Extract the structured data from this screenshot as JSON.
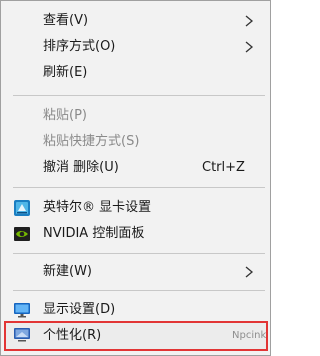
{
  "menu": {
    "view": {
      "label": "查看(V)"
    },
    "sort": {
      "label": "排序方式(O)"
    },
    "refresh": {
      "label": "刷新(E)"
    },
    "paste": {
      "label": "粘贴(P)"
    },
    "paste_shortcut": {
      "label": "粘贴快捷方式(S)"
    },
    "undo_delete": {
      "label": "撤消 删除(U)",
      "shortcut": "Ctrl+Z"
    },
    "intel": {
      "label": "英特尔® 显卡设置",
      "icon": "intel-graphics-icon"
    },
    "nvidia": {
      "label": "NVIDIA 控制面板",
      "icon": "nvidia-icon"
    },
    "new": {
      "label": "新建(W)"
    },
    "display": {
      "label": "显示设置(D)",
      "icon": "display-icon"
    },
    "personalize": {
      "label": "个性化(R)",
      "icon": "personalize-icon"
    }
  },
  "watermark": "Npcink",
  "colors": {
    "menu_bg": "#f2f2f2",
    "highlight_border": "#e23535",
    "disabled_text": "#8a8a8a"
  }
}
